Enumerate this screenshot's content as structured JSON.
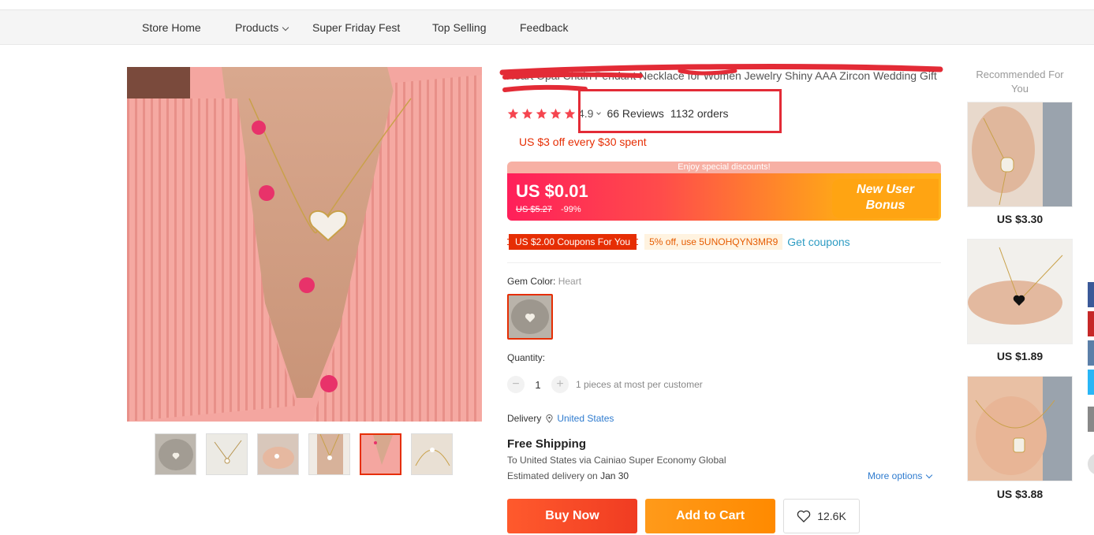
{
  "nav": {
    "items": [
      "Store Home",
      "Products",
      "Super Friday Fest",
      "Top Selling",
      "Feedback"
    ]
  },
  "product": {
    "title": "Heart Opal Chain Pendant Necklace for Women Jewelry Shiny AAA Zircon Wedding Gift",
    "rating": "4.9",
    "reviews": "66 Reviews",
    "orders": "1132 orders",
    "store_discount": "US $3 off every $30 spent",
    "banner_note": "Enjoy special discounts!",
    "price": "US $0.01",
    "old_price": "US $5.27",
    "discount_pct": "-99%",
    "bonus_line1": "New User",
    "bonus_line2": "Bonus",
    "coupon": "US $2.00 Coupons For You",
    "code_offer": "5% off, use 5UNOHQYN3MR9",
    "get_coupons": "Get coupons",
    "gem_label": "Gem Color:",
    "gem_value": "Heart",
    "quantity_label": "Quantity:",
    "quantity": "1",
    "quantity_note": "1 pieces at most per customer",
    "delivery_label": "Delivery",
    "delivery_location": "United States",
    "ship_title": "Free Shipping",
    "ship_via": "To United States via Cainiao Super Economy Global",
    "ship_est_prefix": "Estimated delivery on",
    "ship_est_date": "Jan 30",
    "more_options": "More options",
    "buy_now": "Buy Now",
    "add_to_cart": "Add to Cart",
    "wishlist_count": "12.6K"
  },
  "recommended": {
    "title": "Recommended For You",
    "items": [
      {
        "price": "US $3.30"
      },
      {
        "price": "US $1.89"
      },
      {
        "price": "US $3.88"
      }
    ]
  },
  "colors": {
    "accent": "#e62e04",
    "highlight_box": "#e32b36",
    "link": "#2e7bcf"
  },
  "share_colors": [
    "#3b5998",
    "#c62828",
    "#5b7fa8",
    "#29b6f6",
    "#888888"
  ]
}
